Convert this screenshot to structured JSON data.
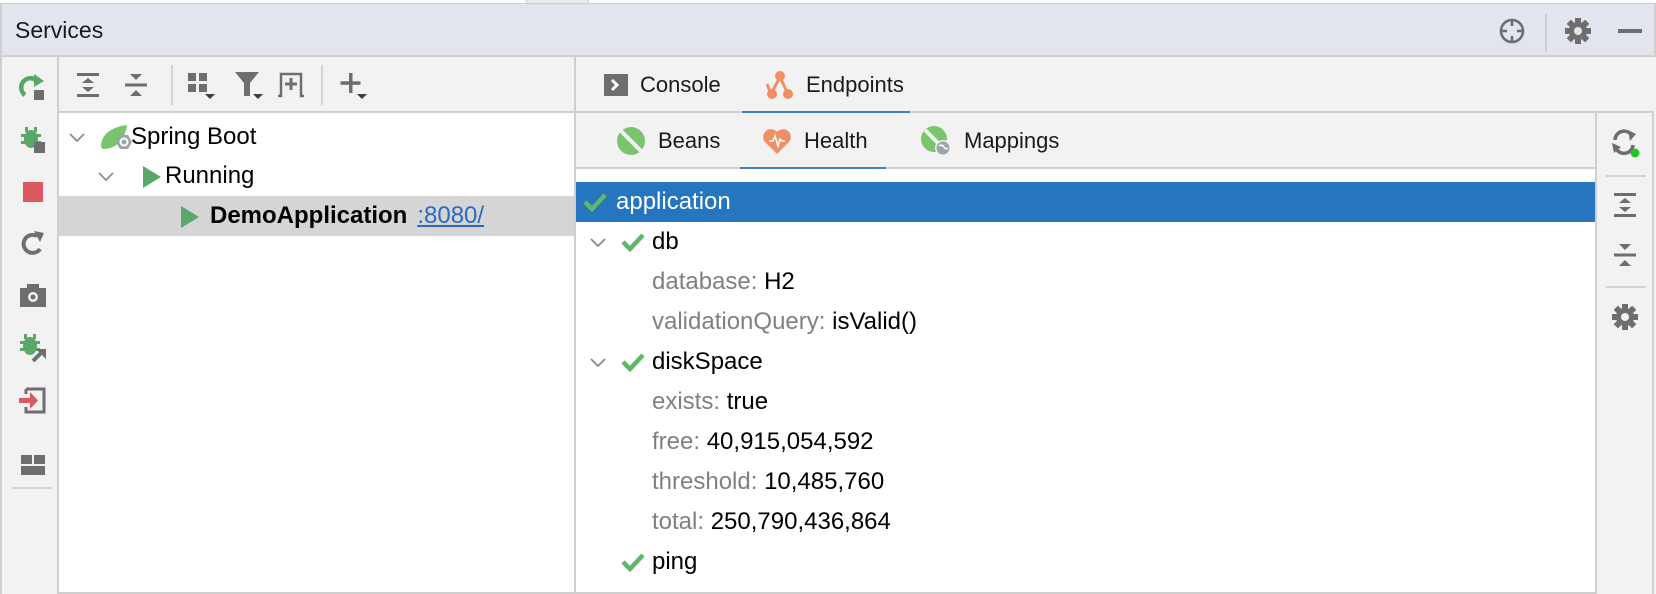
{
  "window": {
    "title": "Services",
    "header_icons": [
      "crosshair-icon",
      "gear-icon",
      "minimize-icon"
    ]
  },
  "left_toolbar": {
    "items": [
      {
        "name": "rerun",
        "icon": "rerun-icon"
      },
      {
        "name": "debug",
        "icon": "debug-icon"
      },
      {
        "name": "stop",
        "icon": "stop-icon"
      },
      {
        "name": "restart",
        "icon": "restart-icon"
      },
      {
        "name": "snapshot",
        "icon": "camera-icon"
      },
      {
        "name": "attach-debugger",
        "icon": "attach-debugger-icon"
      },
      {
        "name": "exit",
        "icon": "exit-icon"
      },
      {
        "name": "layout",
        "icon": "layout-icon"
      }
    ]
  },
  "tree_toolbar": {
    "items": [
      {
        "name": "expand-all",
        "icon": "expand-all-icon"
      },
      {
        "name": "collapse-all",
        "icon": "collapse-all-icon"
      },
      {
        "name": "group-by",
        "icon": "group-icon"
      },
      {
        "name": "filter",
        "icon": "filter-icon"
      },
      {
        "name": "new-tab",
        "icon": "open-in-tab-icon"
      },
      {
        "name": "add-service",
        "icon": "add-icon"
      }
    ]
  },
  "tree": {
    "nodes": [
      {
        "label": "Spring Boot",
        "icon": "spring-boot-icon",
        "expanded": true,
        "level": 0
      },
      {
        "label": "Running",
        "icon": "run-icon",
        "expanded": true,
        "level": 1
      },
      {
        "label": "DemoApplication",
        "link": ":8080/",
        "icon": "run-icon",
        "level": 2,
        "selected": true
      }
    ]
  },
  "tabs": {
    "items": [
      {
        "label": "Console",
        "icon": "console-icon",
        "active": false
      },
      {
        "label": "Endpoints",
        "icon": "endpoints-icon",
        "active": true
      }
    ]
  },
  "subtabs": {
    "items": [
      {
        "label": "Beans",
        "icon": "beans-icon",
        "active": false
      },
      {
        "label": "Health",
        "icon": "health-icon",
        "active": true
      },
      {
        "label": "Mappings",
        "icon": "mappings-icon",
        "active": false
      }
    ]
  },
  "health": {
    "root": {
      "label": "application",
      "status": "UP",
      "selected": true
    },
    "components": [
      {
        "label": "db",
        "status": "UP",
        "expanded": true,
        "details": [
          {
            "key": "database:",
            "value": "H2"
          },
          {
            "key": "validationQuery:",
            "value": "isValid()"
          }
        ]
      },
      {
        "label": "diskSpace",
        "status": "UP",
        "expanded": true,
        "details": [
          {
            "key": "exists:",
            "value": "true"
          },
          {
            "key": "free:",
            "value": "40,915,054,592"
          },
          {
            "key": "threshold:",
            "value": "10,485,760"
          },
          {
            "key": "total:",
            "value": "250,790,436,864"
          }
        ]
      },
      {
        "label": "ping",
        "status": "UP"
      }
    ]
  },
  "right_toolbar": {
    "items": [
      {
        "name": "refresh",
        "icon": "refresh-icon",
        "live_indicator": true
      },
      {
        "name": "expand-all",
        "icon": "expand-all-icon"
      },
      {
        "name": "collapse-all",
        "icon": "collapse-all-icon"
      },
      {
        "name": "settings",
        "icon": "gear-icon"
      }
    ]
  },
  "colors": {
    "accent": "#3f7ec9",
    "selection": "#2675bf",
    "status_ok": "#5fb865",
    "stop": "#db5860",
    "spring": "#6db33f"
  }
}
